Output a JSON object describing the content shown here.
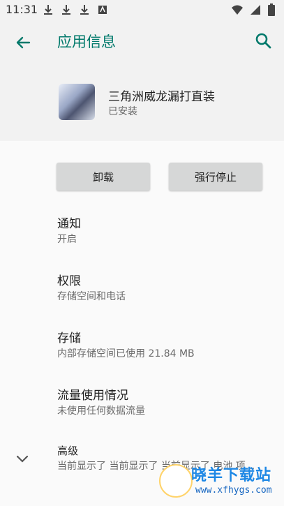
{
  "status_bar": {
    "time": "11:31",
    "left_icons": [
      "download-icon",
      "download-icon",
      "download-icon",
      "notification-icon"
    ],
    "right_icons": [
      "wifi-icon",
      "signal-icon",
      "battery-icon"
    ]
  },
  "app_bar": {
    "title": "应用信息",
    "back_icon": "arrow-back-icon",
    "search_icon": "search-icon",
    "accent_color": "#00796b"
  },
  "app": {
    "name": "三角洲威龙漏打直装",
    "status": "已安装"
  },
  "buttons": {
    "uninstall": "卸载",
    "force_stop": "强行停止"
  },
  "prefs": [
    {
      "title": "通知",
      "summary": "开启"
    },
    {
      "title": "权限",
      "summary": "存储空间和电话"
    },
    {
      "title": "存储",
      "summary": "内部存储空间已使用 21.84 MB"
    },
    {
      "title": "流量使用情况",
      "summary": "未使用任何数据流量"
    }
  ],
  "advanced": {
    "title": "高级",
    "summary": "当前显示了 当前显示了 当前显示了 电池 项..."
  },
  "watermark": {
    "title": "晓羊下载站",
    "url": "www.xfhygs.com"
  }
}
